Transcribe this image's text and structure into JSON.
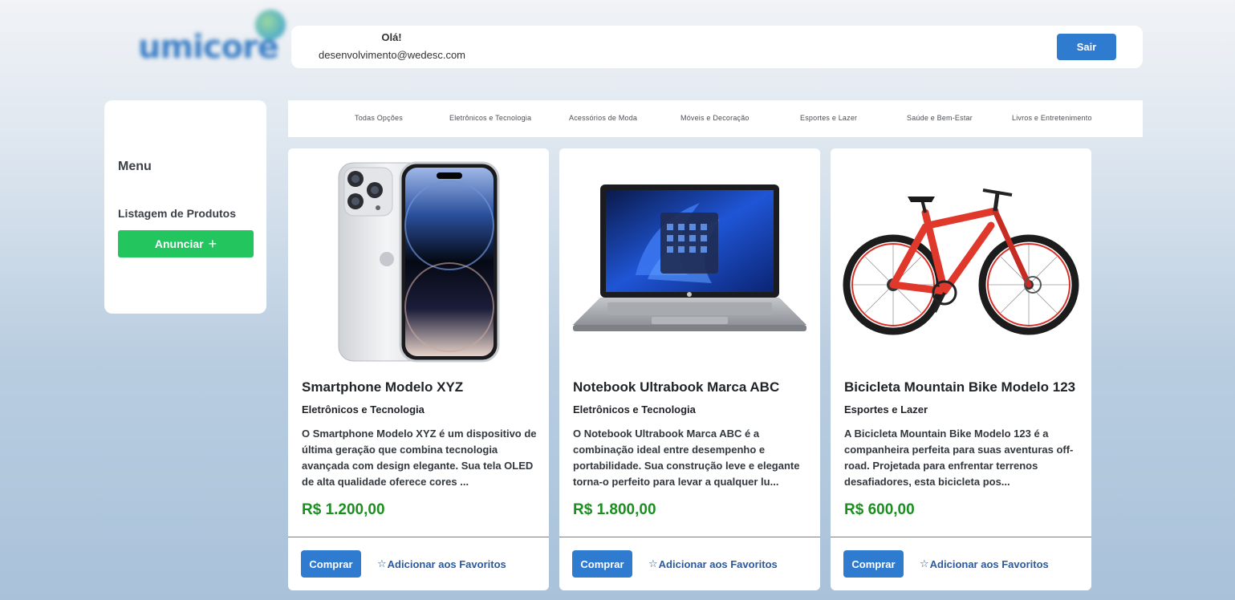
{
  "brand": {
    "logo_text": "umicore"
  },
  "header": {
    "greeting": "Olá!",
    "email": "desenvolvimento@wedesc.com",
    "logout_label": "Sair"
  },
  "sidebar": {
    "title": "Menu",
    "items": [
      {
        "label": "Listagem de Produtos"
      }
    ],
    "add_button_label": "Anunciar"
  },
  "categories": [
    "Todas Opções",
    "Eletrônicos e Tecnologia",
    "Acessórios de Moda",
    "Móveis e Decoração",
    "Esportes e Lazer",
    "Saúde e Bem-Estar",
    "Livros e Entretenimento"
  ],
  "products": [
    {
      "title": "Smartphone Modelo XYZ",
      "category": "Eletrônicos e Tecnologia",
      "description": "O Smartphone Modelo XYZ é um dispositivo de última geração que combina tecnologia avançada com design elegante. Sua tela OLED de alta qualidade oferece cores ...",
      "price": "R$ 1.200,00",
      "image": "smartphone-image",
      "buy_label": "Comprar",
      "favorite_label": "Adicionar aos Favoritos"
    },
    {
      "title": "Notebook Ultrabook Marca ABC",
      "category": "Eletrônicos e Tecnologia",
      "description": "O Notebook Ultrabook Marca ABC é a combinação ideal entre desempenho e portabilidade. Sua construção leve e elegante torna-o perfeito para levar a qualquer lu...",
      "price": "R$ 1.800,00",
      "image": "laptop-image",
      "buy_label": "Comprar",
      "favorite_label": "Adicionar aos Favoritos"
    },
    {
      "title": "Bicicleta Mountain Bike Modelo 123",
      "category": "Esportes e Lazer",
      "description": "A Bicicleta Mountain Bike Modelo 123 é a companheira perfeita para suas aventuras off-road. Projetada para enfrentar terrenos desafiadores, esta bicicleta pos...",
      "price": "R$ 600,00",
      "image": "bicycle-image",
      "buy_label": "Comprar",
      "favorite_label": "Adicionar aos Favoritos"
    }
  ],
  "colors": {
    "primary_button": "#2e7bd0",
    "add_button": "#22c55e",
    "price": "#1a8f1f",
    "favorite_link": "#2b5aa0"
  }
}
